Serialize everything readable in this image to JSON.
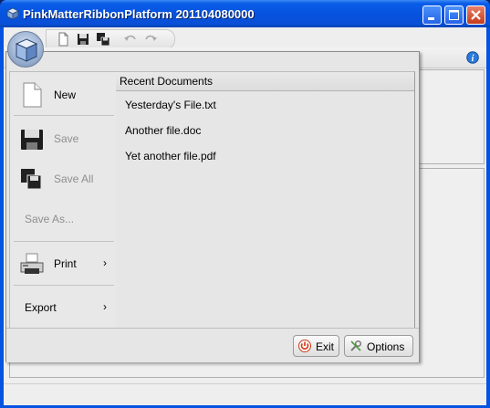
{
  "window": {
    "title": "PinkMatterRibbonPlatform 201104080000",
    "controls": [
      "minimize",
      "maximize",
      "close"
    ]
  },
  "quick_access_toolbar": {
    "icons": [
      "new-document-icon",
      "save-icon",
      "save-all-icon",
      "undo-icon",
      "redo-icon"
    ]
  },
  "app_menu": {
    "items": [
      {
        "label": "New",
        "enabled": true,
        "icon": "new-document-icon"
      },
      {
        "label": "Save",
        "enabled": false,
        "icon": "save-icon"
      },
      {
        "label": "Save All",
        "enabled": false,
        "icon": "save-all-icon"
      },
      {
        "label": "Save As...",
        "enabled": false
      },
      {
        "label": "Print",
        "enabled": true,
        "icon": "printer-icon",
        "has_submenu": true
      },
      {
        "label": "Export",
        "enabled": true,
        "has_submenu": true
      }
    ],
    "recent": {
      "header": "Recent Documents",
      "files": [
        "Yesterday's File.txt",
        "Another file.doc",
        "Yet another file.pdf"
      ]
    },
    "footer": {
      "exit_label": "Exit",
      "options_label": "Options"
    },
    "submenu_glyph": "›"
  },
  "colors": {
    "titlebar": "#0553e0",
    "menu_bg": "#e6e6e6",
    "disabled_text": "#8e8e8e"
  }
}
